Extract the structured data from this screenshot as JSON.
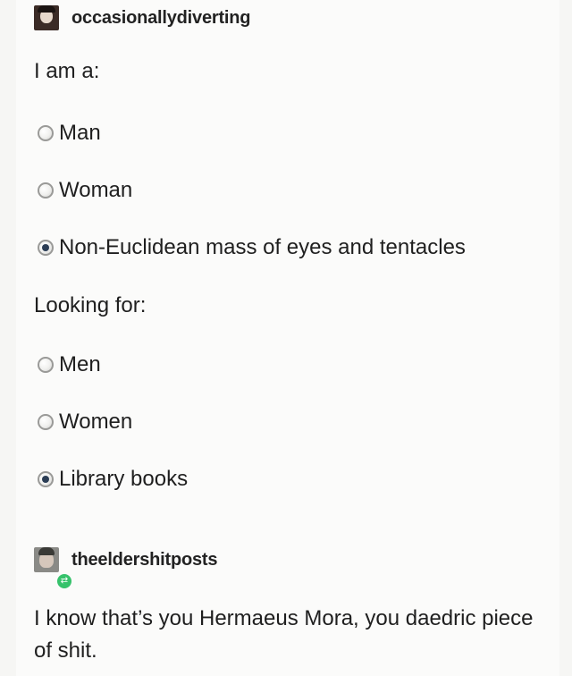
{
  "original_post": {
    "username": "occasionallydiverting",
    "prompt_iam": "I am a:",
    "iam_options": [
      {
        "label": "Man",
        "selected": false
      },
      {
        "label": "Woman",
        "selected": false
      },
      {
        "label": "Non-Euclidean mass of eyes and tentacles",
        "selected": true
      }
    ],
    "prompt_looking": "Looking for:",
    "looking_options": [
      {
        "label": "Men",
        "selected": false
      },
      {
        "label": "Women",
        "selected": false
      },
      {
        "label": "Library books",
        "selected": true
      }
    ]
  },
  "reblog": {
    "username": "theeldershitposts",
    "badge_icon": "reblog-icon",
    "text": "I know that’s you Hermaeus Mora, you daedric piece of shit."
  }
}
